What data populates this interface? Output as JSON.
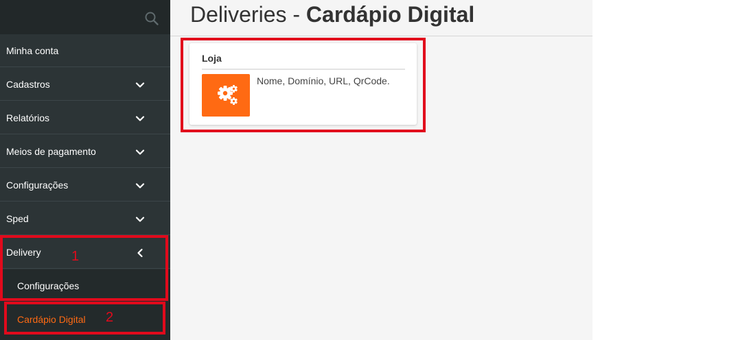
{
  "colors": {
    "sidebar_bg": "#2c3436",
    "accent": "#ff6a13",
    "highlight": "#e10a1c"
  },
  "sidebar": {
    "search_icon": "search-icon",
    "items": [
      {
        "label": "Minha conta"
      },
      {
        "label": "Cadastros",
        "icon": "chevron-down-icon"
      },
      {
        "label": "Relatórios",
        "icon": "chevron-down-icon"
      },
      {
        "label": "Meios de pagamento",
        "icon": "chevron-down-icon"
      },
      {
        "label": "Configurações",
        "icon": "chevron-down-icon"
      },
      {
        "label": "Sped",
        "icon": "chevron-down-icon"
      },
      {
        "label": "Delivery",
        "icon": "chevron-left-icon"
      }
    ],
    "subitems": [
      {
        "label": "Configurações"
      },
      {
        "label": "Cardápio Digital",
        "active": true
      }
    ]
  },
  "header": {
    "title_prefix": "Deliveries - ",
    "title_bold": "Cardápio Digital"
  },
  "card": {
    "title": "Loja",
    "icon": "gears-icon",
    "description": "Nome, Domínio, URL, QrCode."
  },
  "annotations": {
    "step1": "1",
    "step2": "2"
  }
}
